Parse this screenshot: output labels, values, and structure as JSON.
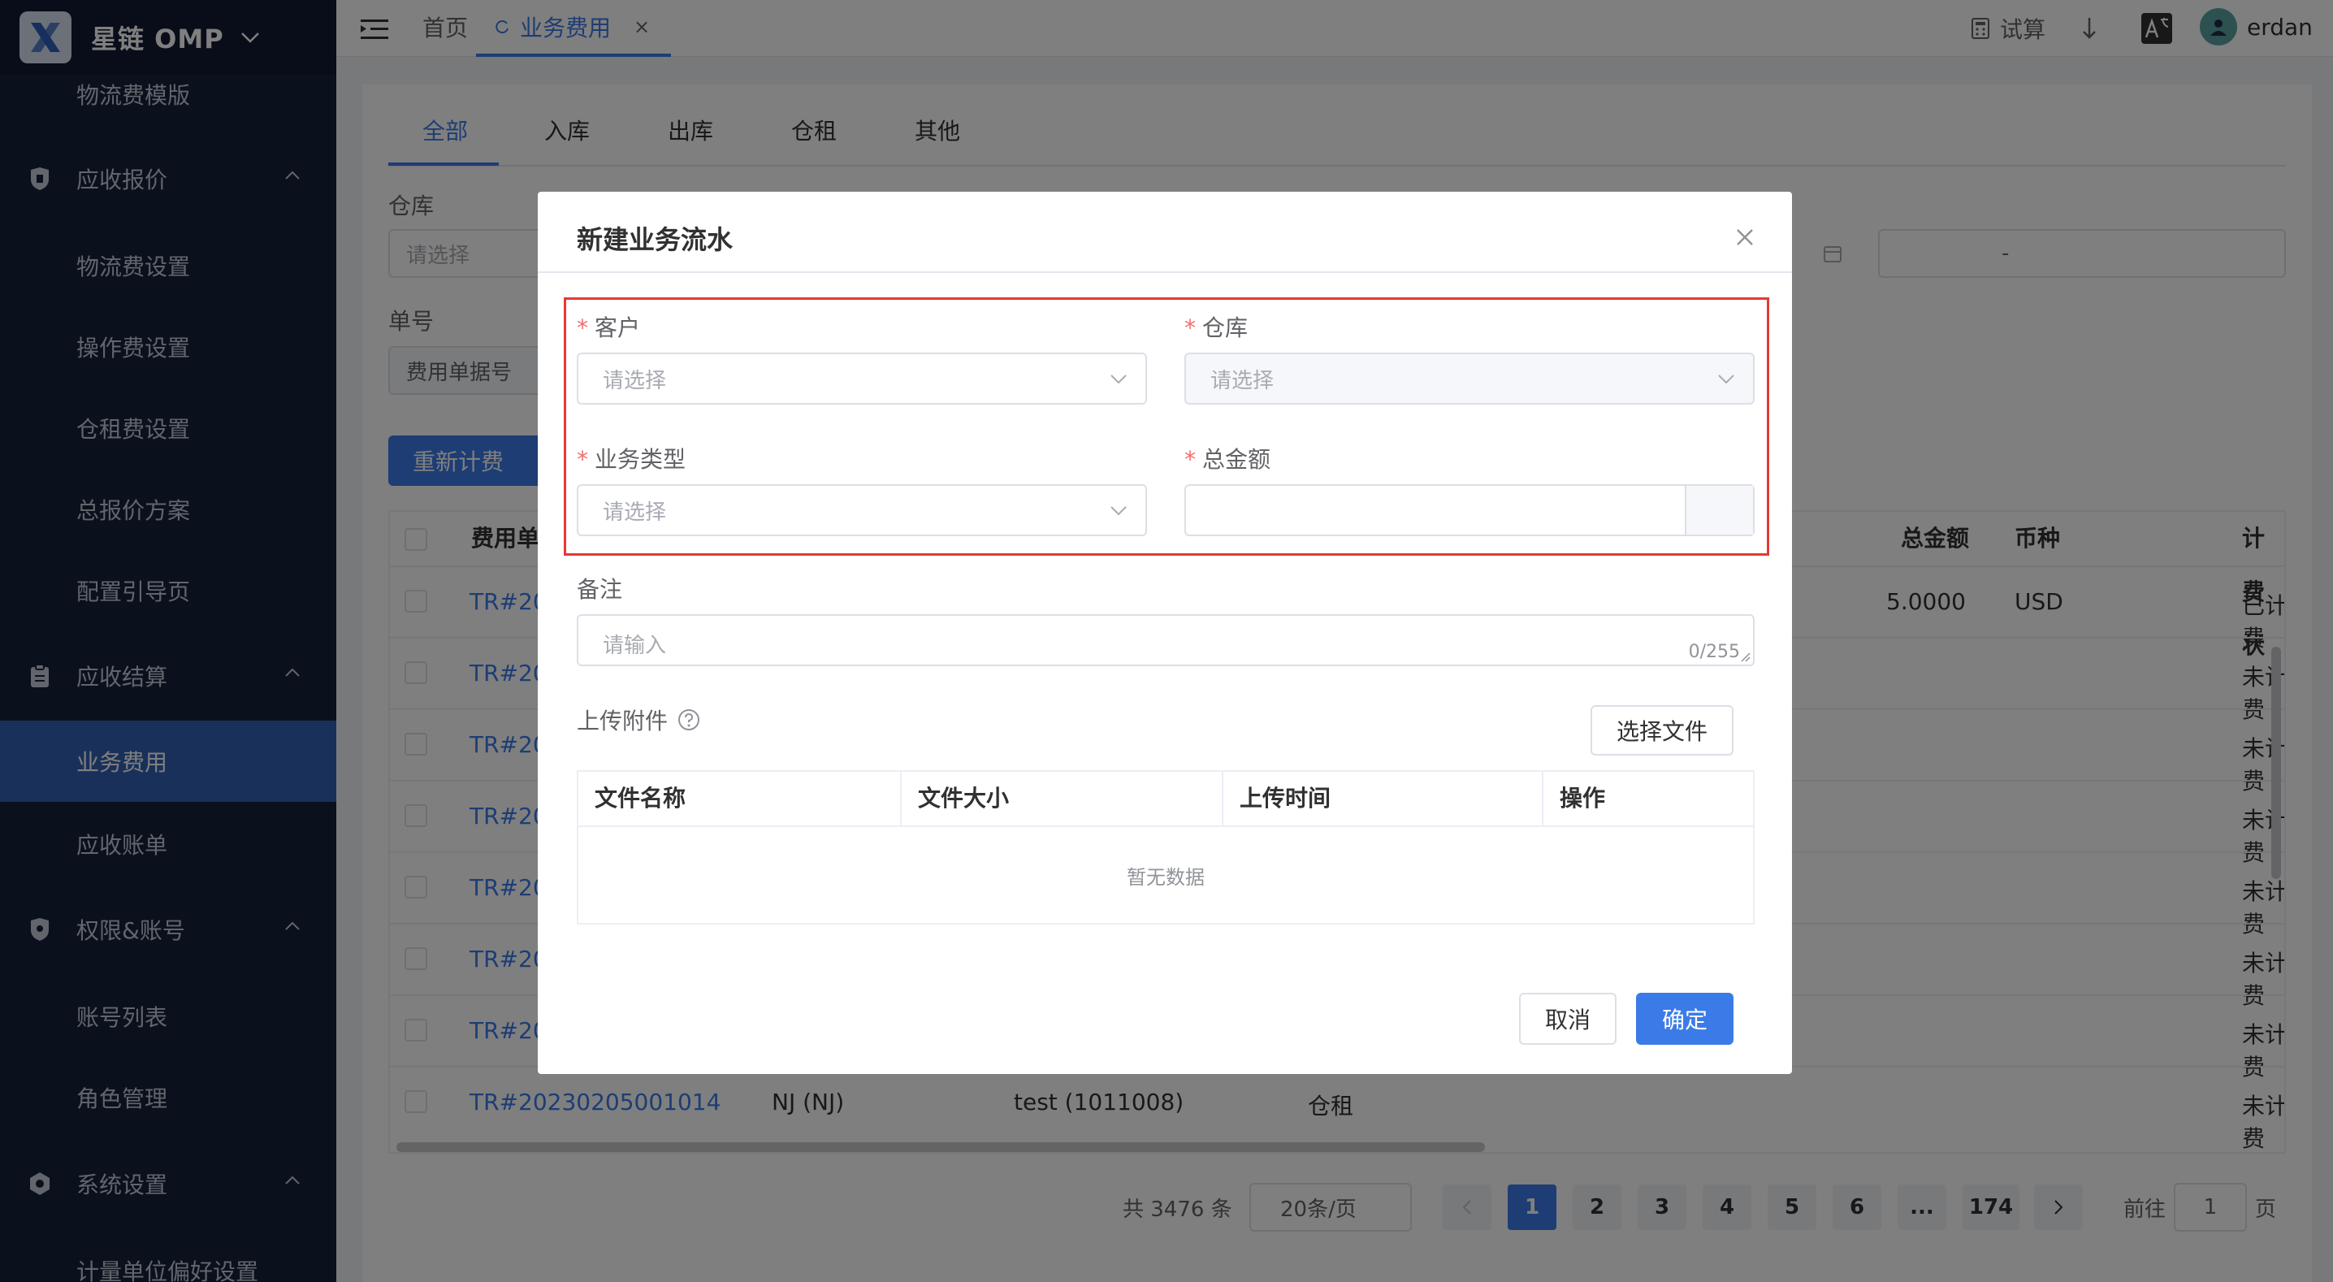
{
  "app": {
    "name": "星链 OMP"
  },
  "sidebar": {
    "items": [
      {
        "label": "物流费模版",
        "type": "sub"
      },
      {
        "label": "应收报价",
        "type": "group",
        "icon": "quote-shield-icon"
      },
      {
        "label": "物流费设置",
        "type": "sub"
      },
      {
        "label": "操作费设置",
        "type": "sub"
      },
      {
        "label": "仓租费设置",
        "type": "sub"
      },
      {
        "label": "总报价方案",
        "type": "sub"
      },
      {
        "label": "配置引导页",
        "type": "sub"
      },
      {
        "label": "应收结算",
        "type": "group",
        "icon": "clipboard-icon"
      },
      {
        "label": "业务费用",
        "type": "sub",
        "active": true
      },
      {
        "label": "应收账单",
        "type": "sub"
      },
      {
        "label": "权限&账号",
        "type": "group",
        "icon": "shield-icon"
      },
      {
        "label": "账号列表",
        "type": "sub"
      },
      {
        "label": "角色管理",
        "type": "sub"
      },
      {
        "label": "系统设置",
        "type": "group",
        "icon": "hexagon-gear-icon"
      },
      {
        "label": "计量单位偏好设置",
        "type": "sub"
      }
    ]
  },
  "topbar": {
    "tabs": [
      {
        "label": "首页"
      },
      {
        "label": "业务费用",
        "active": true,
        "close": "×"
      }
    ],
    "calc_label": "试算",
    "user": "erdan",
    "icons": [
      "menu-fold-icon",
      "calculator-icon",
      "download-arrow-icon",
      "translate-icon",
      "avatar"
    ]
  },
  "page": {
    "tabs": [
      "全部",
      "入库",
      "出库",
      "仓租",
      "其他"
    ],
    "filters": {
      "warehouse_label": "仓库",
      "warehouse_placeholder": "请选择",
      "order_label": "单号",
      "order_type": "费用单据号",
      "date_sep": "-"
    },
    "recalc_label": "重新计费",
    "grid": {
      "headers": [
        "费用单",
        "总金额",
        "币种",
        "计费状"
      ],
      "first_row": {
        "amount": "5.0000",
        "currency": "USD",
        "status": "已计费"
      },
      "row_prefix": "TR#20",
      "row_status": "未计费",
      "last_row": [
        "TR#20230205001014",
        "NJ (NJ)",
        "test (1011008)",
        "仓租"
      ]
    },
    "pagination": {
      "total": "共 3476 条",
      "page_size": "20条/页",
      "pages": [
        "1",
        "2",
        "3",
        "4",
        "5",
        "6",
        "...",
        "174"
      ],
      "goto_label": "前往",
      "goto_value": "1",
      "goto_suffix": "页"
    }
  },
  "dialog": {
    "title": "新建业务流水",
    "fields": {
      "customer": {
        "label": "客户",
        "placeholder": "请选择"
      },
      "warehouse": {
        "label": "仓库",
        "placeholder": "请选择"
      },
      "biz_type": {
        "label": "业务类型",
        "placeholder": "请选择"
      },
      "amount": {
        "label": "总金额"
      },
      "remark": {
        "label": "备注",
        "placeholder": "请输入",
        "count": "0/255"
      }
    },
    "required_mark": "*",
    "upload": {
      "label": "上传附件",
      "button": "选择文件",
      "headers": [
        "文件名称",
        "文件大小",
        "上传时间",
        "操作"
      ],
      "empty": "暂无数据"
    },
    "cancel": "取消",
    "confirm": "确定"
  },
  "colors": {
    "primary": "#3b7be8",
    "sidebar_bg": "#16203a",
    "highlight": "#e53935"
  }
}
